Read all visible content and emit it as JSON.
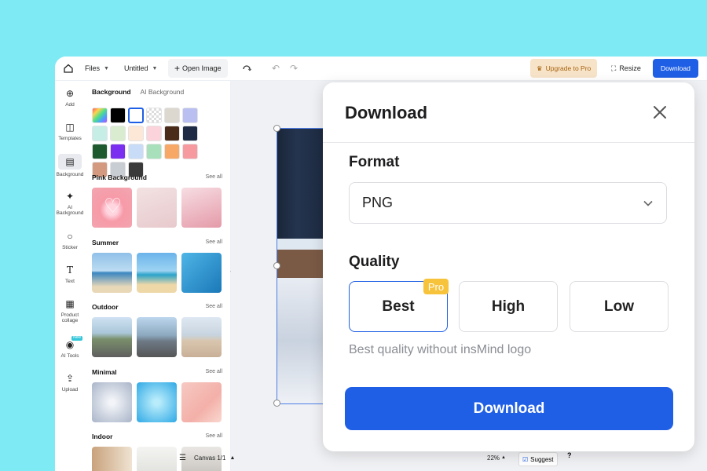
{
  "topbar": {
    "files": "Files",
    "doc_name": "Untitled",
    "open_image": "Open Image",
    "upgrade": "Upgrade to Pro",
    "resize": "Resize",
    "download": "Download"
  },
  "rail": [
    {
      "label": "Add",
      "icon": "add-icon"
    },
    {
      "label": "Templates",
      "icon": "templates-icon"
    },
    {
      "label": "Background",
      "icon": "background-icon"
    },
    {
      "label": "AI Background",
      "icon": "ai-background-icon"
    },
    {
      "label": "Sticker",
      "icon": "sticker-icon"
    },
    {
      "label": "Text",
      "icon": "text-icon"
    },
    {
      "label": "Product collage",
      "icon": "product-collage-icon"
    },
    {
      "label": "AI Tools",
      "icon": "ai-tools-icon",
      "badge": "New"
    },
    {
      "label": "Upload",
      "icon": "upload-icon"
    }
  ],
  "panel": {
    "tab_background": "Background",
    "tab_ai_background": "AI Background",
    "swatches": [
      "gradient-rainbow",
      "#000000",
      "#ffffff",
      "transparent",
      "#dcd7cf",
      "#b9bff0",
      "#c6eee6",
      "#d9ecd0",
      "#fde7d7",
      "#fbd3db",
      "#4a2a18",
      "#1f2b44",
      "#1f5a2f",
      "#7a2ff0",
      "#c9dcf7",
      "#a8e0bc",
      "#f8a866",
      "#f69aa0",
      "#d49a80",
      "#c8ccd3",
      "#3a3a3a"
    ],
    "sections": [
      {
        "title": "Pink Background",
        "see_all": "See all"
      },
      {
        "title": "Summer",
        "see_all": "See all"
      },
      {
        "title": "Outdoor",
        "see_all": "See all"
      },
      {
        "title": "Minimal",
        "see_all": "See all"
      },
      {
        "title": "Indoor",
        "see_all": "See all"
      }
    ]
  },
  "bottombar": {
    "canvas": "Canvas 1/1",
    "zoom": "22%",
    "suggest": "Suggest",
    "help": "?"
  },
  "modal": {
    "title": "Download",
    "format_label": "Format",
    "format_value": "PNG",
    "quality_label": "Quality",
    "quality_options": [
      "Best",
      "High",
      "Low"
    ],
    "selected_quality": "Best",
    "pro_badge": "Pro",
    "hint": "Best quality without insMind logo",
    "download_button": "Download"
  },
  "colors": {
    "accent": "#1f5fe5",
    "background": "#7eeaf4",
    "pro_badge": "#f7c33a"
  }
}
